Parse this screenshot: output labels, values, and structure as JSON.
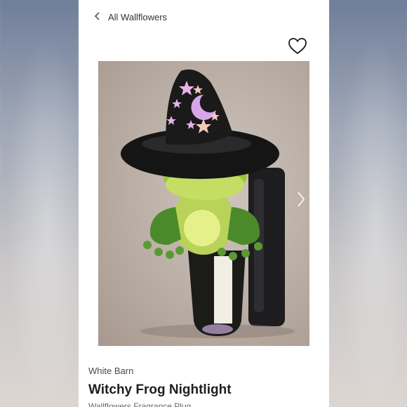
{
  "nav": {
    "back_label": "All Wallflowers"
  },
  "product": {
    "brand": "White Barn",
    "name": "Witchy Frog Nightlight",
    "category_partial": "Wallflowers Fragrance Plug"
  },
  "icons": {
    "back": "chevron-left-icon",
    "favorite": "heart-outline-icon",
    "next_image": "chevron-right-icon"
  },
  "colors": {
    "panel": "#ffffff",
    "text_primary": "#1e1e1e",
    "text_secondary": "#4a4a4a"
  }
}
